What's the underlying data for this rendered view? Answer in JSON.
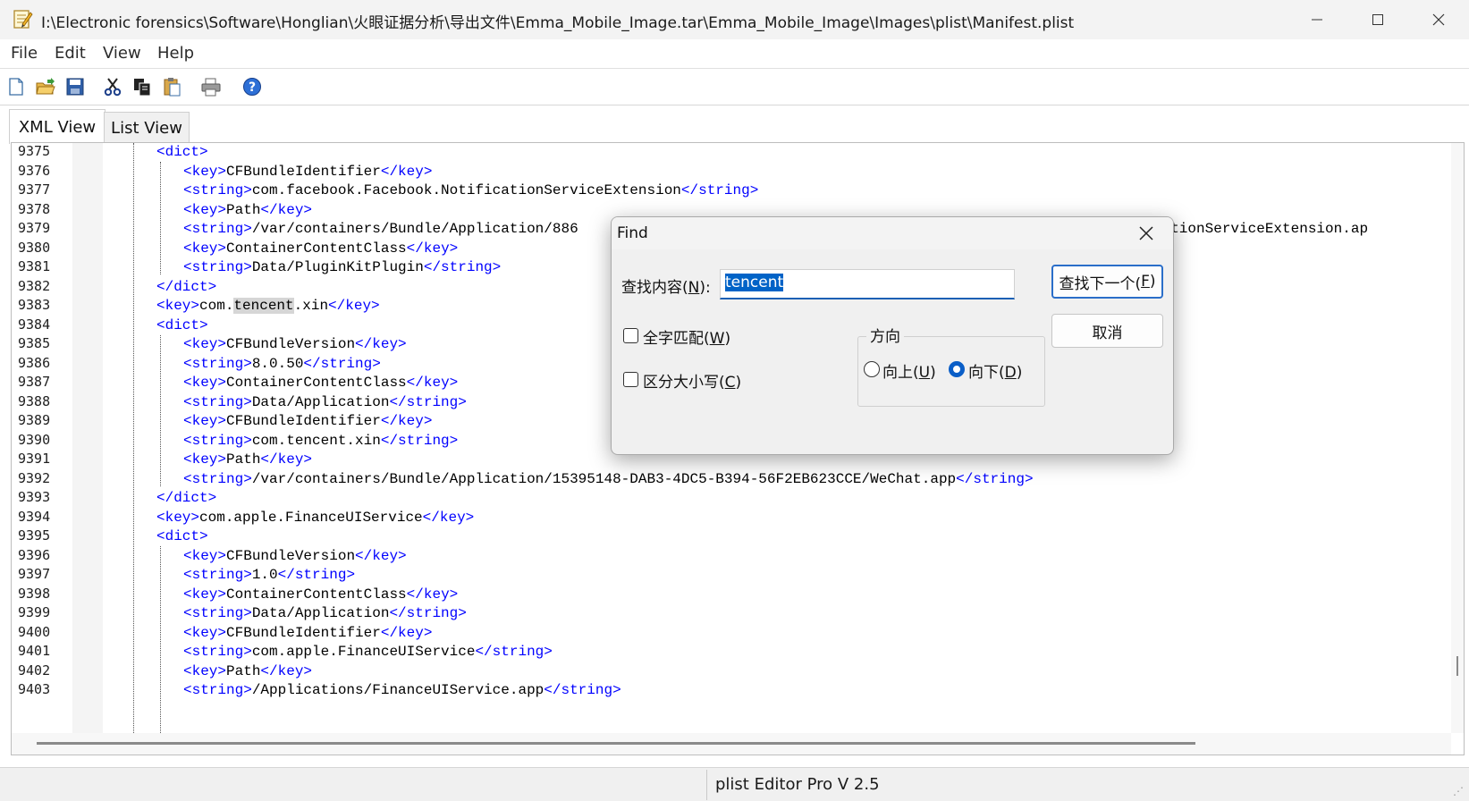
{
  "window": {
    "title": "I:\\Electronic forensics\\Software\\Honglian\\火眼证据分析\\导出文件\\Emma_Mobile_Image.tar\\Emma_Mobile_Image\\Images\\plist\\Manifest.plist",
    "icons": [
      "notepad-icon",
      "minimize-icon",
      "maximize-icon",
      "close-icon"
    ]
  },
  "menu": [
    "File",
    "Edit",
    "View",
    "Help"
  ],
  "toolbar": {
    "buttons": [
      "new-file-icon",
      "open-folder-icon",
      "save-icon",
      "cut-icon",
      "copy-icon",
      "paste-icon",
      "print-icon",
      "help-icon"
    ]
  },
  "tabs": [
    "XML View",
    "List View"
  ],
  "editor": {
    "line_numbers": [
      "9375",
      "9376",
      "9377",
      "9378",
      "9379",
      "9380",
      "9381",
      "9382",
      "9383",
      "9384",
      "9385",
      "9386",
      "9387",
      "9388",
      "9389",
      "9390",
      "9391",
      "9392",
      "9393",
      "9394",
      "9395",
      "9396",
      "9397",
      "9398",
      "9399",
      "9400",
      "9401",
      "9402",
      "9403"
    ],
    "lines": [
      [
        [
          "tag",
          "<dict>"
        ]
      ],
      [
        [
          "tag",
          "<key>"
        ],
        [
          "txt",
          "CFBundleIdentifier"
        ],
        [
          "tag",
          "</key>"
        ]
      ],
      [
        [
          "tag",
          "<string>"
        ],
        [
          "txt",
          "com.facebook.Facebook.NotificationServiceExtension"
        ],
        [
          "tag",
          "</string>"
        ]
      ],
      [
        [
          "tag",
          "<key>"
        ],
        [
          "txt",
          "Path"
        ],
        [
          "tag",
          "</key>"
        ]
      ],
      [
        [
          "tag",
          "<string>"
        ],
        [
          "txt",
          "/var/containers/Bundle/Application/886"
        ]
      ],
      [
        [
          "tag",
          "<key>"
        ],
        [
          "txt",
          "ContainerContentClass"
        ],
        [
          "tag",
          "</key>"
        ]
      ],
      [
        [
          "tag",
          "<string>"
        ],
        [
          "txt",
          "Data/PluginKitPlugin"
        ],
        [
          "tag",
          "</string>"
        ]
      ],
      [
        [
          "tag",
          "</dict>"
        ]
      ],
      [
        [
          "tag",
          "<key>"
        ],
        [
          "txt",
          "com."
        ],
        [
          "hl",
          "tencent"
        ],
        [
          "txt",
          ".xin"
        ],
        [
          "tag",
          "</key>"
        ]
      ],
      [
        [
          "tag",
          "<dict>"
        ]
      ],
      [
        [
          "tag",
          "<key>"
        ],
        [
          "txt",
          "CFBundleVersion"
        ],
        [
          "tag",
          "</key>"
        ]
      ],
      [
        [
          "tag",
          "<string>"
        ],
        [
          "txt",
          "8.0.50"
        ],
        [
          "tag",
          "</string>"
        ]
      ],
      [
        [
          "tag",
          "<key>"
        ],
        [
          "txt",
          "ContainerContentClass"
        ],
        [
          "tag",
          "</key>"
        ]
      ],
      [
        [
          "tag",
          "<string>"
        ],
        [
          "txt",
          "Data/Application"
        ],
        [
          "tag",
          "</string>"
        ]
      ],
      [
        [
          "tag",
          "<key>"
        ],
        [
          "txt",
          "CFBundleIdentifier"
        ],
        [
          "tag",
          "</key>"
        ]
      ],
      [
        [
          "tag",
          "<string>"
        ],
        [
          "txt",
          "com.tencent.xin"
        ],
        [
          "tag",
          "</string>"
        ]
      ],
      [
        [
          "tag",
          "<key>"
        ],
        [
          "txt",
          "Path"
        ],
        [
          "tag",
          "</key>"
        ]
      ],
      [
        [
          "tag",
          "<string>"
        ],
        [
          "txt",
          "/var/containers/Bundle/Application/15395148-DAB3-4DC5-B394-56F2EB623CCE/WeChat.app"
        ],
        [
          "tag",
          "</string>"
        ]
      ],
      [
        [
          "tag",
          "</dict>"
        ]
      ],
      [
        [
          "tag",
          "<key>"
        ],
        [
          "txt",
          "com.apple.FinanceUIService"
        ],
        [
          "tag",
          "</key>"
        ]
      ],
      [
        [
          "tag",
          "<dict>"
        ]
      ],
      [
        [
          "tag",
          "<key>"
        ],
        [
          "txt",
          "CFBundleVersion"
        ],
        [
          "tag",
          "</key>"
        ]
      ],
      [
        [
          "tag",
          "<string>"
        ],
        [
          "txt",
          "1.0"
        ],
        [
          "tag",
          "</string>"
        ]
      ],
      [
        [
          "tag",
          "<key>"
        ],
        [
          "txt",
          "ContainerContentClass"
        ],
        [
          "tag",
          "</key>"
        ]
      ],
      [
        [
          "tag",
          "<string>"
        ],
        [
          "txt",
          "Data/Application"
        ],
        [
          "tag",
          "</string>"
        ]
      ],
      [
        [
          "tag",
          "<key>"
        ],
        [
          "txt",
          "CFBundleIdentifier"
        ],
        [
          "tag",
          "</key>"
        ]
      ],
      [
        [
          "tag",
          "<string>"
        ],
        [
          "txt",
          "com.apple.FinanceUIService"
        ],
        [
          "tag",
          "</string>"
        ]
      ],
      [
        [
          "tag",
          "<key>"
        ],
        [
          "txt",
          "Path"
        ],
        [
          "tag",
          "</key>"
        ]
      ],
      [
        [
          "tag",
          "<string>"
        ],
        [
          "txt",
          "/Applications/FinanceUIService.app"
        ],
        [
          "tag",
          "</string>"
        ]
      ]
    ],
    "depth": [
      0,
      1,
      1,
      1,
      1,
      1,
      1,
      0,
      0,
      0,
      1,
      1,
      1,
      1,
      1,
      1,
      1,
      1,
      0,
      0,
      0,
      1,
      1,
      1,
      1,
      1,
      1,
      1,
      1
    ],
    "occluded_tail": "cationServiceExtension.ap"
  },
  "status": {
    "text": "plist Editor Pro V 2.5"
  },
  "find_dialog": {
    "title": "Find",
    "find_label": "查找内容(",
    "find_label_key": "N",
    "find_label_end": "):",
    "find_value": "tencent",
    "find_next_label": "查找下一个(",
    "find_next_key": "F",
    "find_next_end": ")",
    "cancel_label": "取消",
    "whole_word_label": "全字匹配(",
    "whole_word_key": "W",
    "whole_word_end": ")",
    "whole_word_checked": false,
    "match_case_label": "区分大小写(",
    "match_case_key": "C",
    "match_case_end": ")",
    "match_case_checked": false,
    "direction_label": "方向",
    "up_label": "向上(",
    "up_key": "U",
    "up_end": ")",
    "down_label": "向下(",
    "down_key": "D",
    "down_end": ")",
    "direction_selected": "down"
  }
}
